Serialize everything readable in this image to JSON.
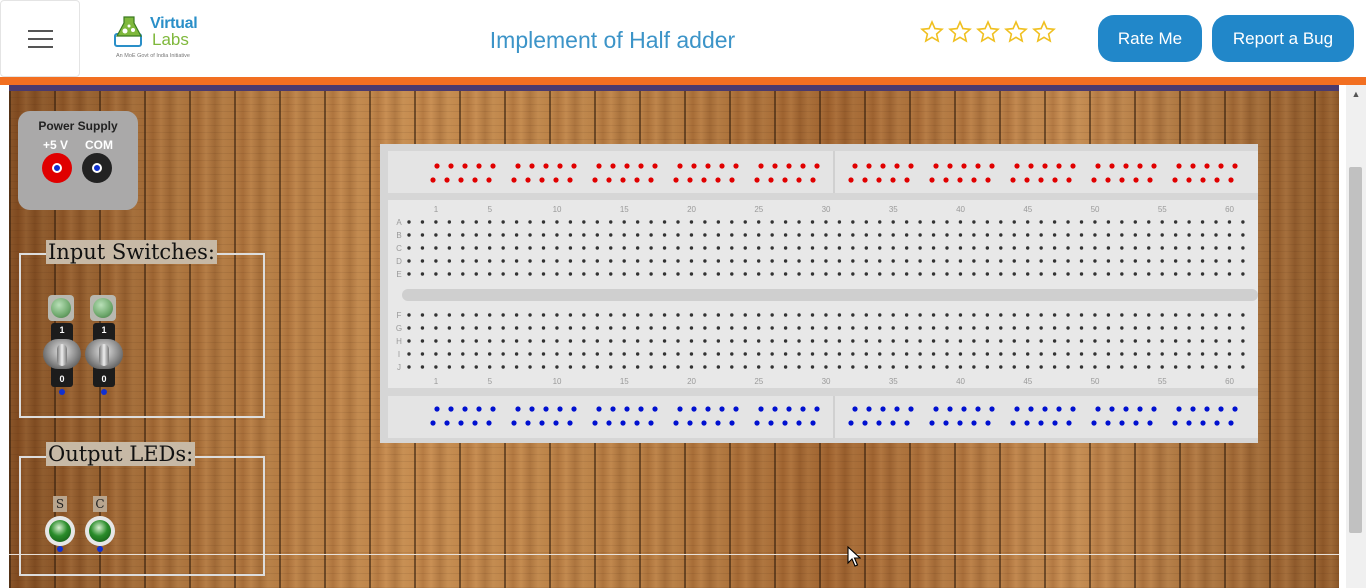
{
  "header": {
    "logo": {
      "line1": "Virtual",
      "line2": "Labs",
      "tagline": "An MoE Govt of India Initiative"
    },
    "title": "Implement of Half adder",
    "rating": {
      "stars": 5,
      "filled": 0
    },
    "rate_label": "Rate Me",
    "bug_label": "Report a Bug"
  },
  "power_supply": {
    "title": "Power Supply",
    "plus_label": "+5 V",
    "com_label": "COM"
  },
  "inputs": {
    "legend": "Input Switches:",
    "switches": [
      {
        "on": "1",
        "off": "0"
      },
      {
        "on": "1",
        "off": "0"
      }
    ]
  },
  "outputs": {
    "legend": "Output LEDs:",
    "leds": [
      {
        "label": "S"
      },
      {
        "label": "C"
      }
    ]
  },
  "breadboard": {
    "row_letters_top": [
      "A",
      "B",
      "C",
      "D",
      "E"
    ],
    "row_letters_bottom": [
      "F",
      "G",
      "H",
      "I",
      "J"
    ],
    "column_numbers": [
      "1",
      "5",
      "10",
      "15",
      "20",
      "25",
      "30",
      "35",
      "40",
      "45",
      "50",
      "55",
      "60"
    ],
    "rail_top_color": "#e00000",
    "rail_bottom_color": "#0010d0"
  },
  "colors": {
    "accent": "#2187c9",
    "title": "#3c94c8",
    "header_bar": "#f26f21",
    "star": "#f0c020",
    "power_plus": "#e00000",
    "power_com": "#222222"
  }
}
